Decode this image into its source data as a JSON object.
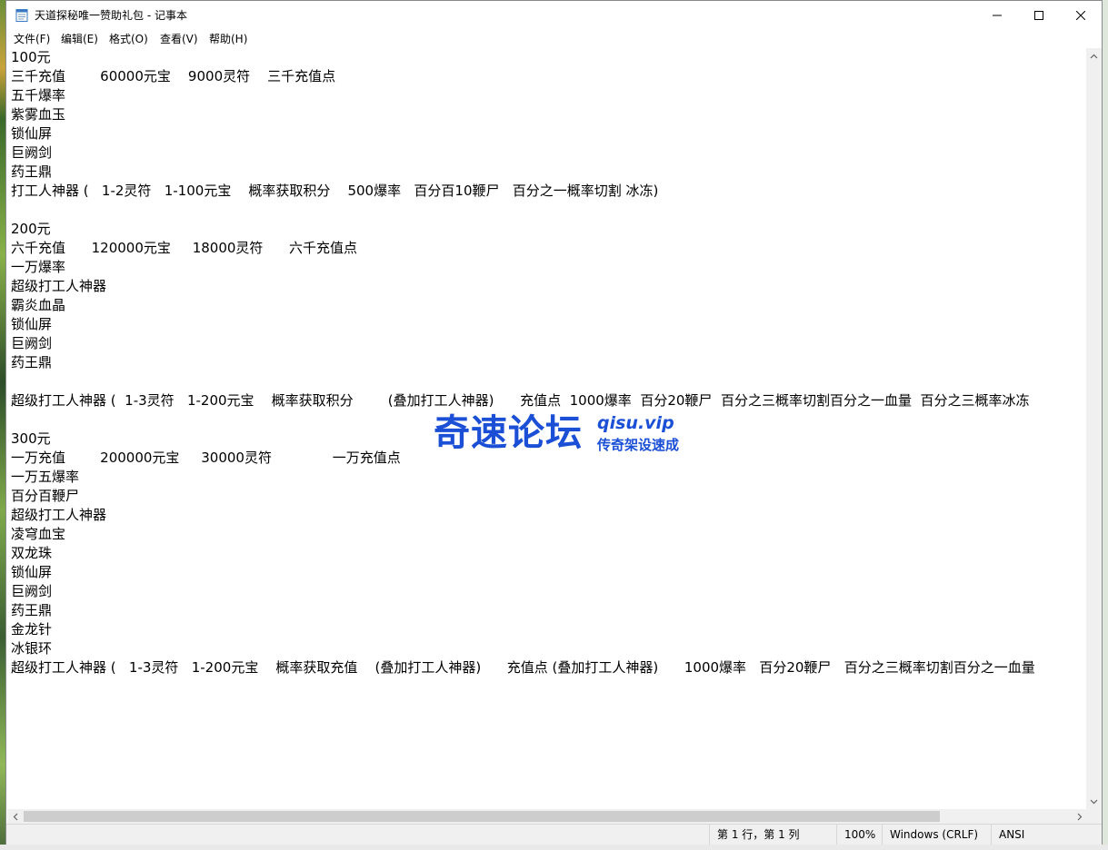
{
  "window": {
    "title": "天道探秘唯一赞助礼包 - 记事本"
  },
  "menu": {
    "items": [
      "文件(F)",
      "编辑(E)",
      "格式(O)",
      "查看(V)",
      "帮助(H)"
    ]
  },
  "document": {
    "lines": [
      "100元",
      "三千充值        60000元宝    9000灵符    三千充值点",
      "五千爆率",
      "紫雾血玉",
      "锁仙屏",
      "巨阙剑",
      "药王鼎",
      "打工人神器 (   1-2灵符   1-100元宝    概率获取积分    500爆率   百分百10鞭尸   百分之一概率切割 冰冻)",
      "",
      "200元",
      "六千充值      120000元宝     18000灵符      六千充值点",
      "一万爆率",
      "超级打工人神器",
      "霸炎血晶",
      "锁仙屏",
      "巨阙剑",
      "药王鼎",
      "",
      "超级打工人神器 (  1-3灵符   1-200元宝    概率获取积分        (叠加打工人神器)      充值点  1000爆率  百分20鞭尸  百分之三概率切割百分之一血量  百分之三概率冰冻",
      "",
      "300元",
      "一万充值        200000元宝     30000灵符              一万充值点",
      "一万五爆率",
      "百分百鞭尸",
      "超级打工人神器",
      "凌穹血宝",
      "双龙珠",
      "锁仙屏",
      "巨阙剑",
      "药王鼎",
      "金龙针",
      "冰银环",
      "超级打工人神器 (   1-3灵符   1-200元宝    概率获取充值    (叠加打工人神器)      充值点 (叠加打工人神器)      1000爆率   百分20鞭尸   百分之三概率切割百分之一血量"
    ]
  },
  "statusbar": {
    "position": "第 1 行，第 1 列",
    "zoom": "100%",
    "line_ending": "Windows (CRLF)",
    "encoding": "ANSI"
  },
  "watermark": {
    "brand": "奇速论坛",
    "url": "qisu.vip",
    "tagline": "传奇架设速成"
  },
  "icons": {
    "app": "notepad-icon",
    "minimize": "minimize-icon",
    "maximize": "maximize-icon",
    "close": "close-icon"
  }
}
